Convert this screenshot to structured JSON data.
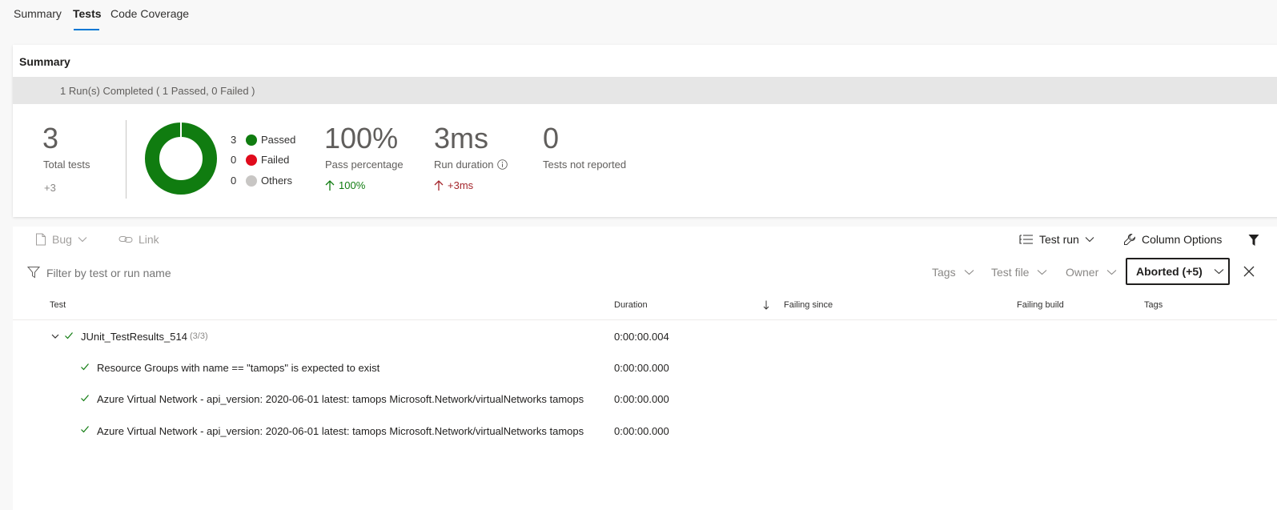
{
  "tabs": [
    {
      "label": "Summary"
    },
    {
      "label": "Tests"
    },
    {
      "label": "Code Coverage"
    }
  ],
  "summary": {
    "title": "Summary",
    "banner": "1 Run(s) Completed ( 1 Passed, 0 Failed )",
    "total_tests": "3",
    "total_tests_label": "Total tests",
    "total_delta": "+3",
    "legend": [
      {
        "count": "3",
        "label": "Passed",
        "color": "#107c10"
      },
      {
        "count": "0",
        "label": "Failed",
        "color": "#e00b1c"
      },
      {
        "count": "0",
        "label": "Others",
        "color": "#c8c6c4"
      }
    ],
    "pass_pct": "100%",
    "pass_pct_label": "Pass percentage",
    "pass_delta": "100%",
    "run_duration": "3ms",
    "run_duration_label": "Run duration",
    "run_delta": "+3ms",
    "not_reported": "0",
    "not_reported_label": "Tests not reported"
  },
  "toolbar": {
    "bug": "Bug",
    "link": "Link",
    "test_run": "Test run",
    "column_options": "Column Options"
  },
  "filters": {
    "placeholder": "Filter by test or run name",
    "tags": "Tags",
    "test_file": "Test file",
    "owner": "Owner",
    "outcome": "Aborted (+5)"
  },
  "table": {
    "headers": {
      "test": "Test",
      "duration": "Duration",
      "failing_since": "Failing since",
      "failing_build": "Failing build",
      "tags": "Tags"
    },
    "group": {
      "name": "JUnit_TestResults_514",
      "count": "(3/3)",
      "duration": "0:00:00.004"
    },
    "rows": [
      {
        "name": "Resource Groups with name == \"tamops\" is expected to exist",
        "duration": "0:00:00.000"
      },
      {
        "name": "Azure Virtual Network - api_version: 2020-06-01 latest: tamops Microsoft.Network/virtualNetworks tamops",
        "duration": "0:00:00.000"
      },
      {
        "name": "Azure Virtual Network - api_version: 2020-06-01 latest: tamops Microsoft.Network/virtualNetworks tamops",
        "duration": "0:00:00.000"
      }
    ]
  }
}
